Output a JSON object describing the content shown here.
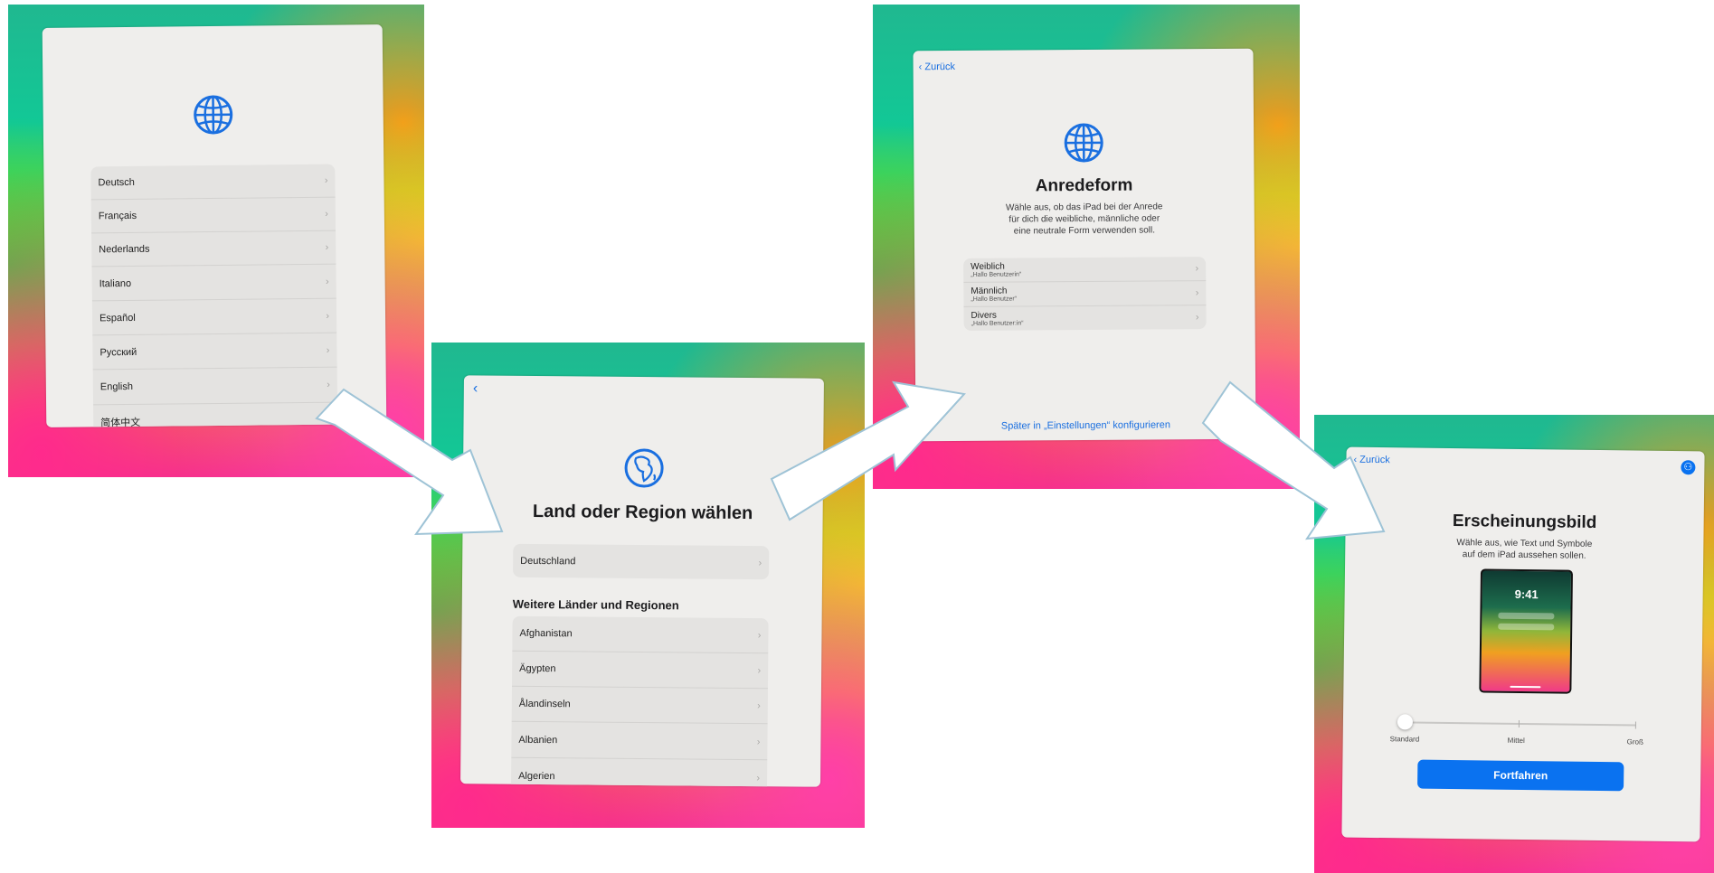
{
  "panel1": {
    "languages": [
      "Deutsch",
      "Français",
      "Nederlands",
      "Italiano",
      "Español",
      "Русский",
      "English",
      "简体中文"
    ]
  },
  "panel2": {
    "title": "Land oder Region wählen",
    "selected": "Deutschland",
    "section_header": "Weitere Länder und Regionen",
    "countries": [
      "Afghanistan",
      "Ägypten",
      "Ålandinseln",
      "Albanien",
      "Algerien"
    ]
  },
  "panel3": {
    "back_label": "Zurück",
    "title": "Anredeform",
    "subtitle_lines": [
      "Wähle aus, ob das iPad bei der Anrede",
      "für dich die weibliche, männliche oder",
      "eine neutrale Form verwenden soll."
    ],
    "options": [
      {
        "label": "Weiblich",
        "example": "„Hallo Benutzerin“"
      },
      {
        "label": "Männlich",
        "example": "„Hallo Benutzer“"
      },
      {
        "label": "Divers",
        "example": "„Hallo Benutzer:in“"
      }
    ],
    "later_link": "Später in „Einstellungen“ konfigurieren"
  },
  "panel4": {
    "back_label": "Zurück",
    "title": "Erscheinungsbild",
    "subtitle_lines": [
      "Wähle aus, wie Text und Symbole",
      "auf dem iPad aussehen sollen."
    ],
    "preview_time": "9:41",
    "slider_labels": [
      "Standard",
      "Mittel",
      "Groß"
    ],
    "slider_value": 0,
    "continue_label": "Fortfahren"
  },
  "colors": {
    "accent": "#0a72f0",
    "screen_bg": "#efeeec",
    "list_bg": "#e4e3e1"
  },
  "icons": [
    "globe-icon",
    "earth-africa-icon",
    "chevron-right-icon",
    "chevron-left-icon",
    "accessibility-icon",
    "arrow-icon"
  ]
}
